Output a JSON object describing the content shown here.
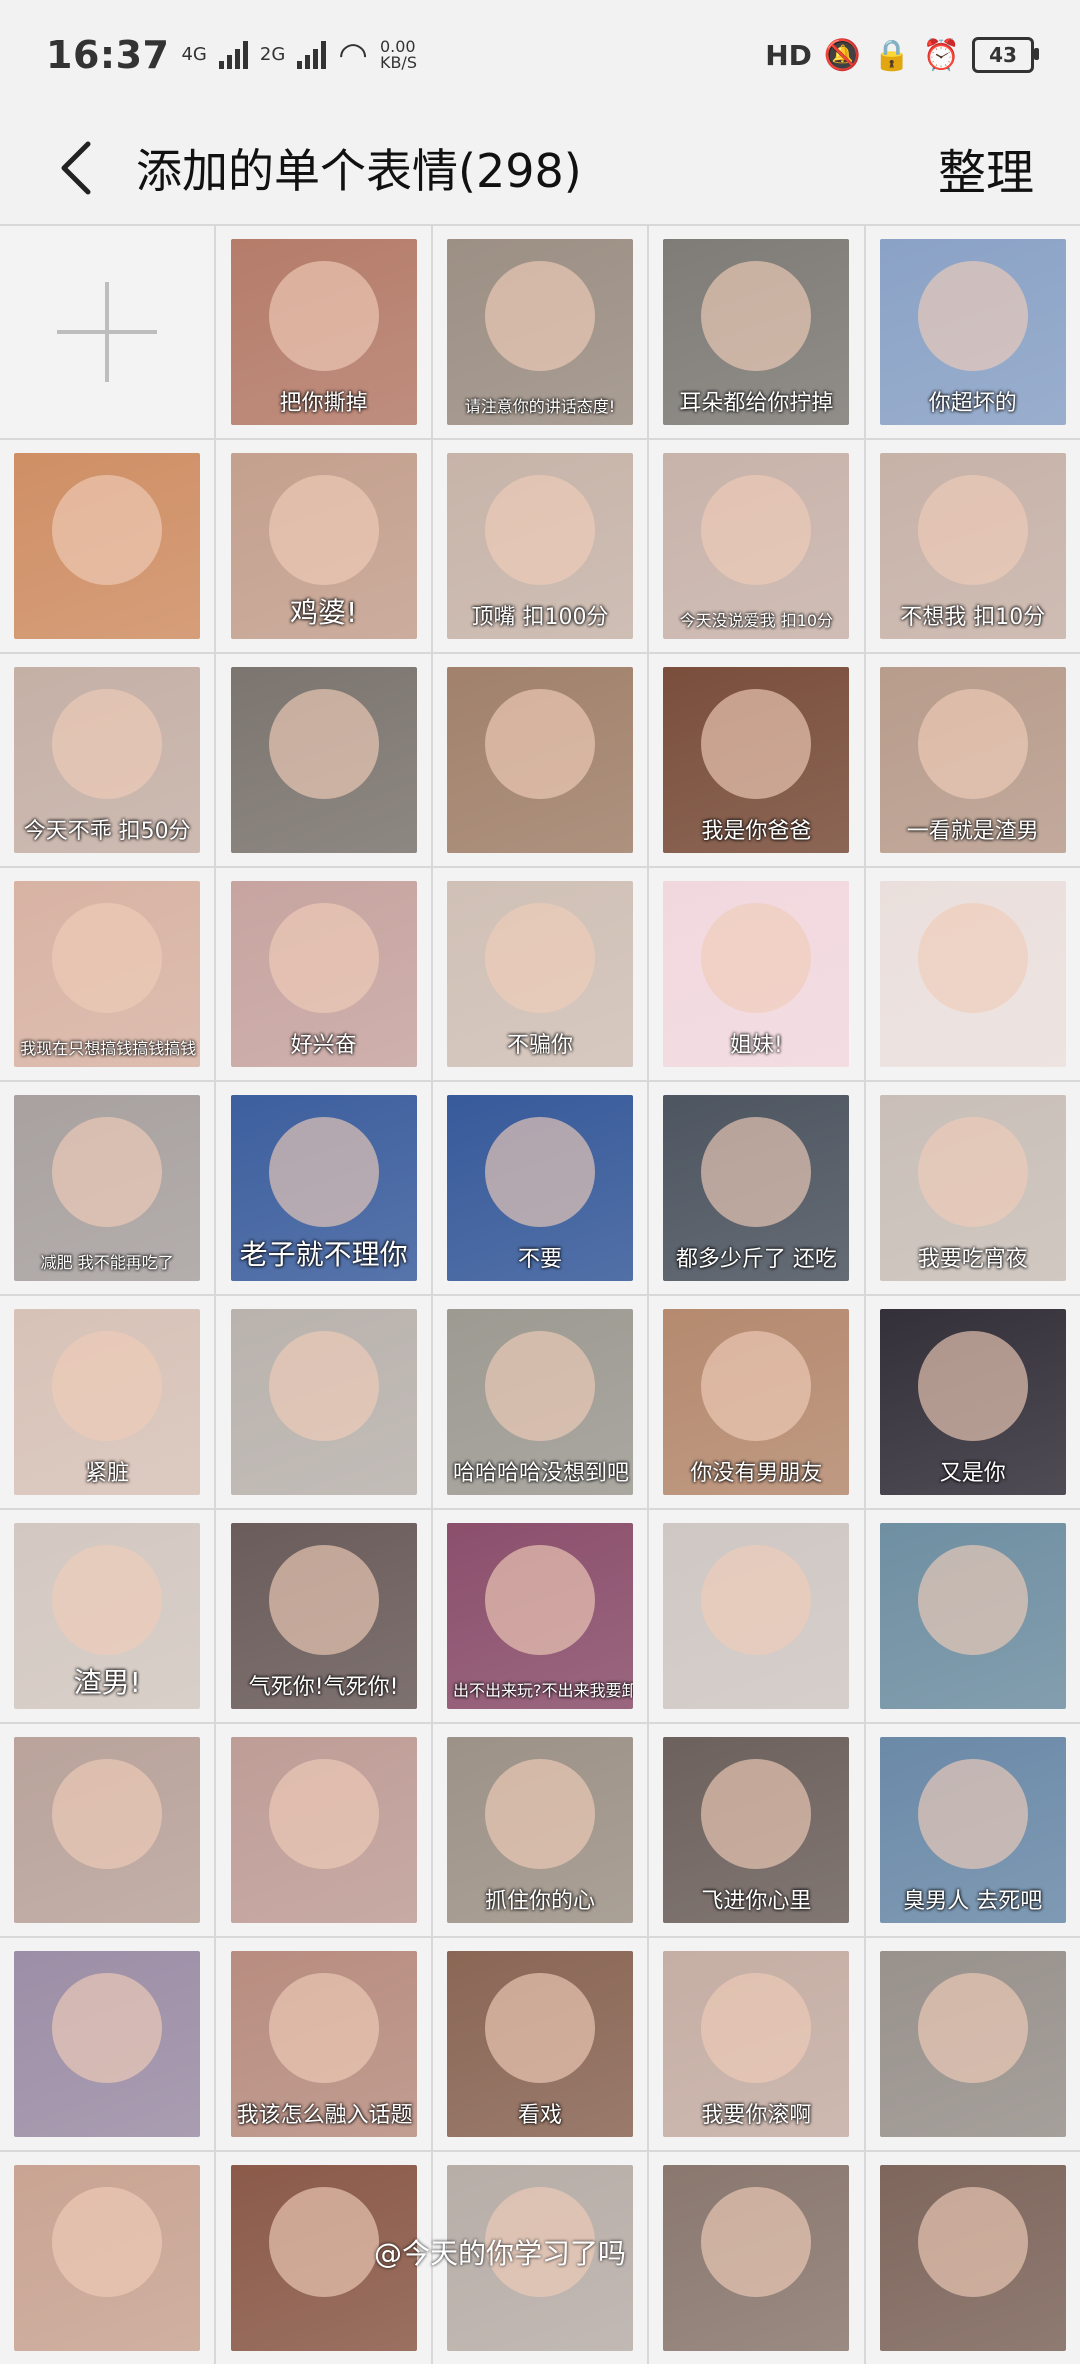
{
  "status_bar": {
    "time": "16:37",
    "network_left": "4G",
    "network_right": "2G",
    "speed_value": "0.00",
    "speed_unit": "KB/S",
    "hd_label": "HD",
    "battery": "43"
  },
  "header": {
    "title": "添加的单个表情(298)",
    "organize": "整理"
  },
  "watermark": "@今天的你学习了吗",
  "stickers": [
    {
      "caption": "把你撕掉",
      "bg": "#b57c6a"
    },
    {
      "caption": "请注意你的讲话态度!",
      "bg": "#9c8f84",
      "size": "small"
    },
    {
      "caption": "耳朵都给你拧掉",
      "bg": "#7f7c77"
    },
    {
      "caption": "你超坏的",
      "bg": "#8aa2c6"
    },
    {
      "caption": "",
      "bg": "#cf8f65"
    },
    {
      "caption": "鸡婆!",
      "bg": "#c4a08e",
      "size": "large"
    },
    {
      "caption": "顶嘴 扣100分",
      "bg": "#c7b4a9"
    },
    {
      "caption": "今天没说爱我 扣10分",
      "bg": "#c8b3aa",
      "size": "small"
    },
    {
      "caption": "不想我 扣10分",
      "bg": "#c7b2a8"
    },
    {
      "caption": "今天不乖 扣50分",
      "bg": "#c5b0a6"
    },
    {
      "caption": "",
      "bg": "#7c756f"
    },
    {
      "caption": "",
      "bg": "#a1816b"
    },
    {
      "caption": "我是你爸爸",
      "bg": "#7a4e3b"
    },
    {
      "caption": "一看就是渣男",
      "bg": "#b89c8c"
    },
    {
      "caption": "我现在只想搞钱搞钱搞钱",
      "bg": "#d8b3a4",
      "size": "small"
    },
    {
      "caption": "好兴奋",
      "bg": "#c7a4a0"
    },
    {
      "caption": "不骗你",
      "bg": "#d0c0b6"
    },
    {
      "caption": "姐妹!",
      "bg": "#f1d8de"
    },
    {
      "caption": "",
      "bg": "#eadfdc"
    },
    {
      "caption": "减肥 我不能再吃了",
      "bg": "#a8a19f",
      "size": "small"
    },
    {
      "caption": "老子就不理你",
      "bg": "#3d5f9e",
      "size": "large"
    },
    {
      "caption": "不要",
      "bg": "#375a9a"
    },
    {
      "caption": "都多少斤了 还吃",
      "bg": "#4d5560"
    },
    {
      "caption": "我要吃宵夜",
      "bg": "#c9bfb8"
    },
    {
      "caption": "紧脏",
      "bg": "#d7c2b7"
    },
    {
      "caption": "",
      "bg": "#b9b2ad"
    },
    {
      "caption": "哈哈哈哈没想到吧",
      "bg": "#9d9a92"
    },
    {
      "caption": "你没有男朋友",
      "bg": "#b58a6f"
    },
    {
      "caption": "又是你",
      "bg": "#34303a"
    },
    {
      "caption": "渣男!",
      "bg": "#d3c8c1",
      "size": "large"
    },
    {
      "caption": "气死你!气死你!",
      "bg": "#6a5c5a"
    },
    {
      "caption": "出不出来玩?不出来我要卸妆了",
      "bg": "#8b4f6c",
      "size": "small"
    },
    {
      "caption": "",
      "bg": "#cfc7c3"
    },
    {
      "caption": "",
      "bg": "#6f8fa2"
    },
    {
      "caption": "",
      "bg": "#b9a39b"
    },
    {
      "caption": "",
      "bg": "#bf9d97"
    },
    {
      "caption": "抓住你的心",
      "bg": "#9d9287"
    },
    {
      "caption": "飞进你心里",
      "bg": "#6d615d"
    },
    {
      "caption": "臭男人 去死吧",
      "bg": "#6b8aa8"
    },
    {
      "caption": "",
      "bg": "#9c8ea6"
    },
    {
      "caption": "我该怎么融入话题",
      "bg": "#b88d80"
    },
    {
      "caption": "看戏",
      "bg": "#8a6655"
    },
    {
      "caption": "我要你滚啊",
      "bg": "#c5aea4"
    },
    {
      "caption": "",
      "bg": "#98918c"
    },
    {
      "caption": "",
      "bg": "#c9a493"
    },
    {
      "caption": "",
      "bg": "#8b5a49"
    },
    {
      "caption": "",
      "bg": "#b8aea8"
    },
    {
      "caption": "",
      "bg": "#8a786f"
    },
    {
      "caption": "",
      "bg": "#7e665c"
    }
  ]
}
